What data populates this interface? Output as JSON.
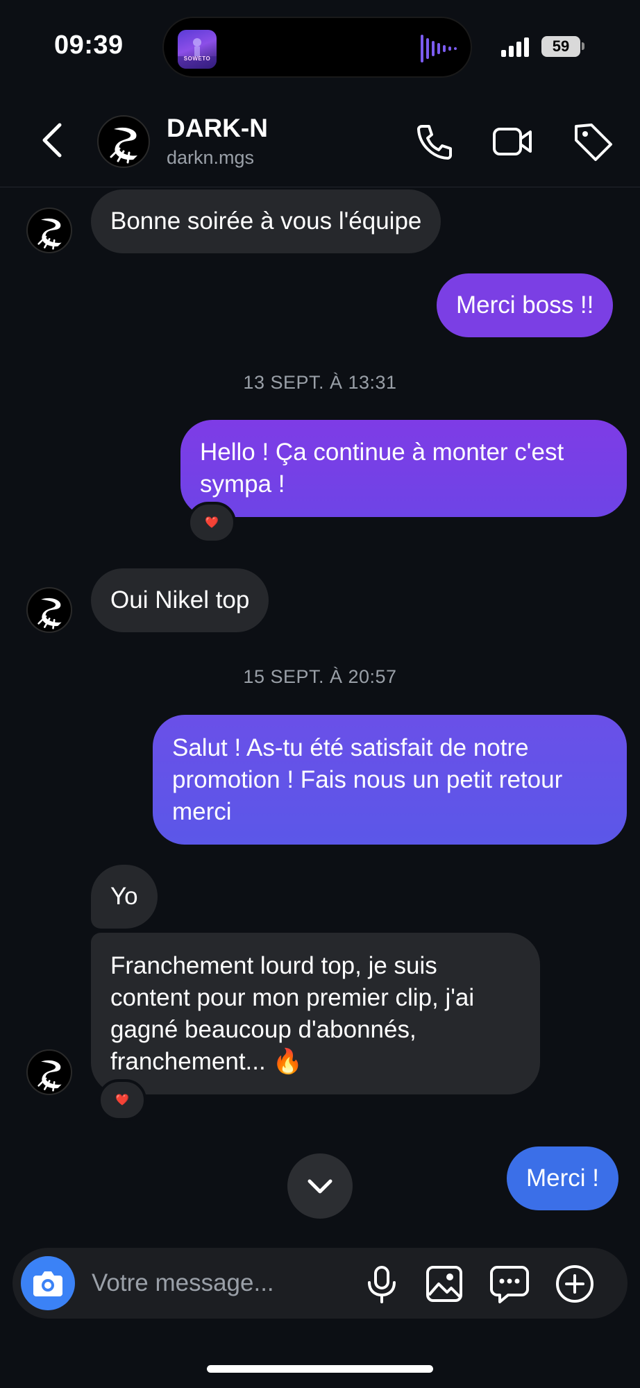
{
  "status_bar": {
    "time": "09:39",
    "battery": "59",
    "now_playing_art_text": "SOWETO"
  },
  "header": {
    "contact_name": "DARK-N",
    "contact_handle": "darkn.mgs"
  },
  "messages": [
    {
      "direction": "in",
      "text": "Bonne soirée à vous l'équipe"
    },
    {
      "direction": "out",
      "text": "Merci boss !!"
    },
    {
      "type": "timestamp",
      "text": "13 SEPT. À 13:31"
    },
    {
      "direction": "out",
      "text": "Hello ! Ça continue à monter c'est sympa !",
      "reaction": "❤️"
    },
    {
      "direction": "in",
      "text": "Oui Nikel top"
    },
    {
      "type": "timestamp",
      "text": "15 SEPT. À 20:57"
    },
    {
      "direction": "out",
      "text": "Salut ! As-tu été satisfait de notre promotion ! Fais nous un petit retour merci"
    },
    {
      "direction": "in",
      "text": "Yo"
    },
    {
      "direction": "in",
      "text": "Franchement lourd top, je suis content pour mon premier clip, j'ai gagné beaucoup d'abonnés, franchement... 🔥",
      "reaction": "❤️"
    },
    {
      "direction": "out",
      "text": "Merci !"
    }
  ],
  "composer": {
    "placeholder": "Votre message..."
  },
  "colors": {
    "background": "#0c0f14",
    "incoming_bubble": "#26282c",
    "outgoing_purple": "#7b3fe4",
    "outgoing_indigo": "#5b57e8",
    "outgoing_blue": "#3b6fe8",
    "camera_button": "#3b82f6"
  },
  "icons": [
    "back-arrow-icon",
    "phone-icon",
    "video-camera-icon",
    "tag-icon",
    "chevron-down-icon",
    "camera-icon",
    "microphone-icon",
    "image-icon",
    "sticker-chat-icon",
    "plus-circle-icon"
  ]
}
